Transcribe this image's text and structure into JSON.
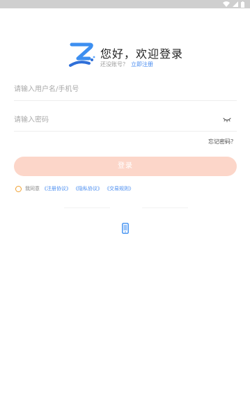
{
  "status_bar": {
    "icons": [
      "wifi-icon",
      "signal-icon",
      "battery-icon"
    ]
  },
  "header": {
    "greeting": "您好，欢迎登录",
    "no_account_text": "还没账号？",
    "register_link": "立即注册"
  },
  "form": {
    "username_placeholder": "请输入用户名/手机号",
    "password_placeholder": "请输入密码",
    "forgot_password": "忘记密码？",
    "login_button": "登录"
  },
  "agreement": {
    "prefix": "我同意",
    "links": [
      "《注册协议》",
      "《隐私协议》",
      "《交易规则》"
    ]
  },
  "other_login": {
    "icons": [
      "phone-icon"
    ]
  },
  "colors": {
    "accent": "#4a8df0",
    "login_button_bg": "#fcd6c9",
    "checkbox_border": "#f0a030",
    "status_bar_bg": "#cfcfcf"
  }
}
